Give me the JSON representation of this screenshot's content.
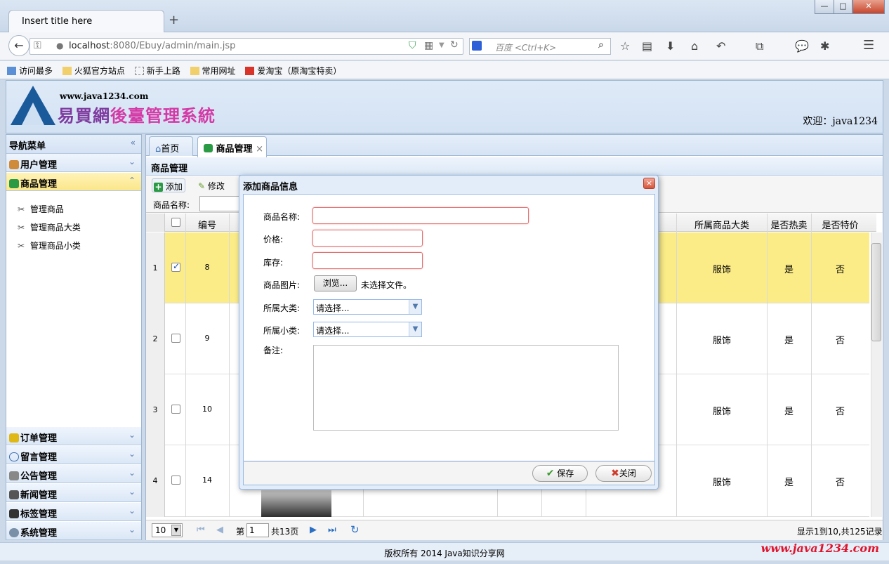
{
  "browser": {
    "tab_title": "Insert title here",
    "new_tab": "+",
    "url_host": "localhost",
    "url_rest": ":8080/Ebuy/admin/main.jsp",
    "search_placeholder": "百度 <Ctrl+K>",
    "win_min": "—",
    "win_max": "□",
    "win_close": "✕",
    "bookmarks": [
      "访问最多",
      "火狐官方站点",
      "新手上路",
      "常用网址",
      "爱淘宝（原淘宝特卖）"
    ]
  },
  "header": {
    "site_url": "www.java1234.com",
    "system_title_a": "易買網",
    "system_title_b": "後臺管理系統",
    "welcome": "欢迎：java1234"
  },
  "nav": {
    "title": "导航菜单",
    "sections": [
      {
        "label": "用户管理",
        "color": "#d08b3a"
      },
      {
        "label": "商品管理",
        "color": "#2b9a44"
      },
      {
        "label": "订单管理",
        "color": "#e0b816"
      },
      {
        "label": "留言管理",
        "color": "#3b6fb2"
      },
      {
        "label": "公告管理",
        "color": "#666666"
      },
      {
        "label": "新闻管理",
        "color": "#555555"
      },
      {
        "label": "标签管理",
        "color": "#333333"
      },
      {
        "label": "系统管理",
        "color": "#7a8fa8"
      }
    ],
    "product_items": [
      "管理商品",
      "管理商品大类",
      "管理商品小类"
    ]
  },
  "tabs": {
    "home": "首页",
    "product": "商品管理",
    "close": "×"
  },
  "panel": {
    "title": "商品管理"
  },
  "toolbar": {
    "add": "添加",
    "edit": "修改",
    "search_label": "商品名称:"
  },
  "grid": {
    "columns": {
      "id": "编号",
      "category": "所属商品大类",
      "hot": "是否热卖",
      "special": "是否特价"
    },
    "rows": [
      {
        "num": "1",
        "id": "8",
        "category": "服饰",
        "hot": "是",
        "special": "否",
        "checked": true
      },
      {
        "num": "2",
        "id": "9",
        "category": "服饰",
        "hot": "是",
        "special": "否",
        "checked": false
      },
      {
        "num": "3",
        "id": "10",
        "category": "服饰",
        "hot": "是",
        "special": "否",
        "checked": false
      },
      {
        "num": "4",
        "id": "14",
        "category": "服饰",
        "hot": "是",
        "special": "否",
        "checked": false
      }
    ]
  },
  "pager": {
    "page_size": "10",
    "page_prefix": "第",
    "page_value": "1",
    "page_total": "共13页",
    "summary": "显示1到10,共125记录"
  },
  "footer": {
    "copyright": "版权所有 2014 Java知识分享网",
    "brand_url": "www.java1234.com"
  },
  "dialog": {
    "title": "添加商品信息",
    "close": "×",
    "name_label": "商品名称:",
    "price_label": "价格:",
    "stock_label": "库存:",
    "image_label": "商品图片:",
    "browse": "浏览...",
    "no_file": "未选择文件。",
    "bigtype_label": "所属大类:",
    "bigtype_value": "请选择...",
    "smalltype_label": "所属小类:",
    "smalltype_value": "请选择...",
    "remark_label": "备注:",
    "save": "保存",
    "close_btn": "关闭"
  }
}
